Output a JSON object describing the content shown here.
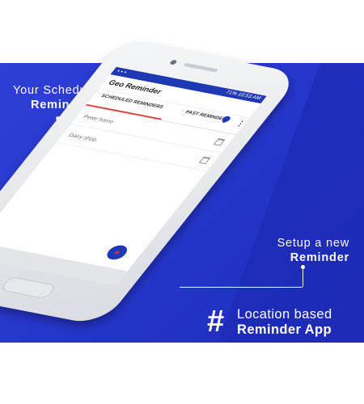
{
  "callouts": {
    "scheduled_line1": "Your Scheduled",
    "scheduled_line2": "Reminders",
    "setup_line1": "Setup a new",
    "setup_line2": "Reminder"
  },
  "tagline": {
    "hash": "#",
    "line1": "Location based",
    "line2": "Reminder App"
  },
  "app": {
    "status": {
      "battery": "71%",
      "time": "10:53 AM"
    },
    "title": "Geo Reminder",
    "tabs": [
      {
        "label": "SCHEDULED REMINDERS",
        "active": true
      },
      {
        "label": "PAST REMINDERS",
        "active": false
      }
    ],
    "reminders": [
      {
        "name": "Peter home"
      },
      {
        "name": "Dairy shop"
      }
    ],
    "fab_icon": "add-icon",
    "accent": "#1f39b4",
    "tab_indicator": "#e53935"
  }
}
